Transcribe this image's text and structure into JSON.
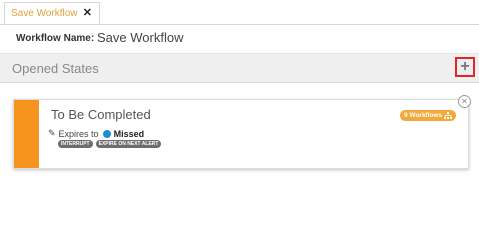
{
  "tab": {
    "label": "Save Workflow",
    "close_glyph": "✕"
  },
  "form": {
    "name_label": "Workflow Name:",
    "name_value": "Save Workflow"
  },
  "states": {
    "title": "Opened States",
    "add_glyph": "+"
  },
  "state_card": {
    "title": "To Be Completed",
    "workflows_badge": "9 Workflows",
    "expires_prefix": "Expires to",
    "target_state": "Missed",
    "tags": [
      "INTERRUPT",
      "EXPIRE ON NEXT ALERT"
    ],
    "accent_color": "#f7941d",
    "dot_color": "#1e8bd4"
  }
}
